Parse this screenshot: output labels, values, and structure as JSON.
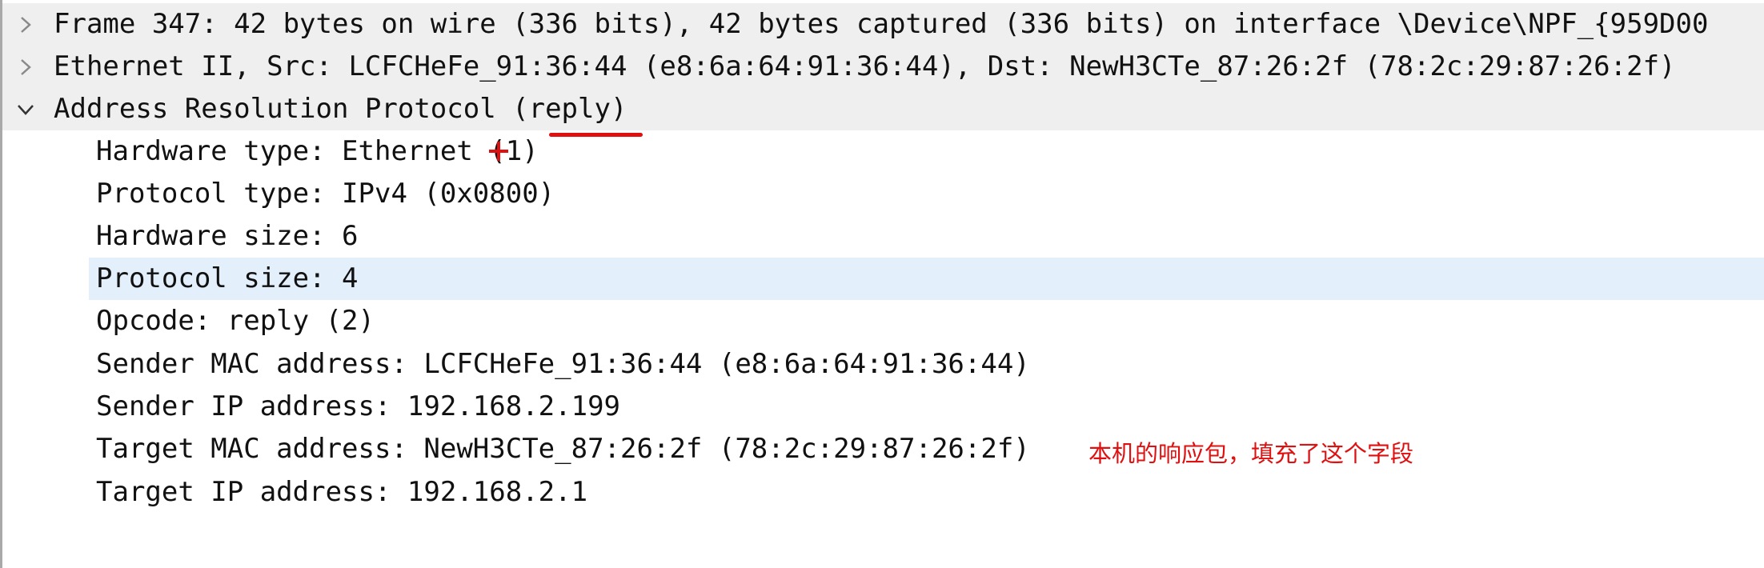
{
  "tree": {
    "headers": [
      {
        "text": "Frame 347: 42 bytes on wire (336 bits), 42 bytes captured (336 bits) on interface \\Device\\NPF_{959D00",
        "expanded": false
      },
      {
        "text": "Ethernet II, Src: LCFCHeFe_91:36:44 (e8:6a:64:91:36:44), Dst: NewH3CTe_87:26:2f (78:2c:29:87:26:2f)",
        "expanded": false
      },
      {
        "text": "Address Resolution Protocol (reply)",
        "expanded": true
      }
    ],
    "fields": [
      {
        "text": "Hardware type: Ethernet (1)"
      },
      {
        "text": "Protocol type: IPv4 (0x0800)"
      },
      {
        "text": "Hardware size: 6"
      },
      {
        "text": "Protocol size: 4",
        "selected": true
      },
      {
        "text": "Opcode: reply (2)"
      },
      {
        "text": "Sender MAC address: LCFCHeFe_91:36:44 (e8:6a:64:91:36:44)"
      },
      {
        "text": "Sender IP address: 192.168.2.199"
      },
      {
        "text": "Target MAC address: NewH3CTe_87:26:2f (78:2c:29:87:26:2f)"
      },
      {
        "text": "Target IP address: 192.168.2.1"
      }
    ]
  },
  "annotation": {
    "note": "本机的响应包，填充了这个字段",
    "color": "#e01010"
  },
  "colors": {
    "header_bg": "#efefef",
    "selected_bg": "#e3effb",
    "text": "#111111"
  },
  "icons": {
    "collapsed": "chevron-right-icon",
    "expanded": "chevron-down-icon"
  }
}
